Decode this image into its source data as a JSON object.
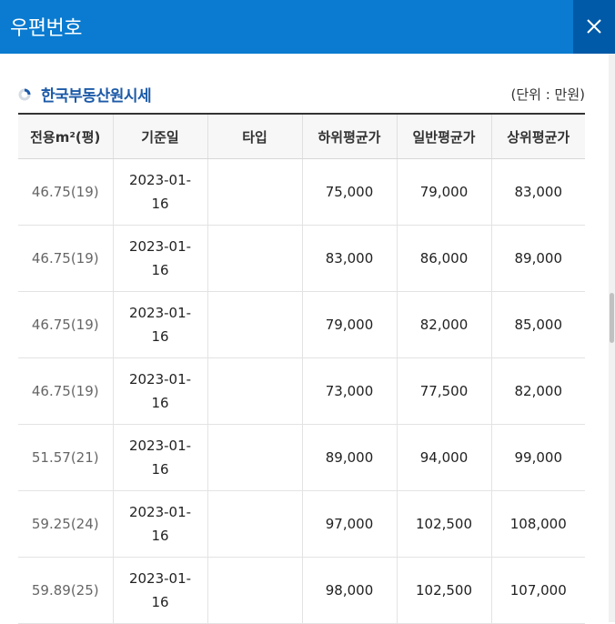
{
  "header": {
    "title": "우편번호"
  },
  "section": {
    "title": "한국부동산원시세",
    "unit_note": "(단위 : 만원)"
  },
  "table": {
    "columns": [
      "전용m²(평)",
      "기준일",
      "타입",
      "하위평균가",
      "일반평균가",
      "상위평균가"
    ],
    "rows": [
      {
        "area": "46.75(19)",
        "date_line1": "2023-01-",
        "date_line2": "16",
        "type": "",
        "low": "75,000",
        "mid": "79,000",
        "high": "83,000"
      },
      {
        "area": "46.75(19)",
        "date_line1": "2023-01-",
        "date_line2": "16",
        "type": "",
        "low": "83,000",
        "mid": "86,000",
        "high": "89,000"
      },
      {
        "area": "46.75(19)",
        "date_line1": "2023-01-",
        "date_line2": "16",
        "type": "",
        "low": "79,000",
        "mid": "82,000",
        "high": "85,000"
      },
      {
        "area": "46.75(19)",
        "date_line1": "2023-01-",
        "date_line2": "16",
        "type": "",
        "low": "73,000",
        "mid": "77,500",
        "high": "82,000"
      },
      {
        "area": "51.57(21)",
        "date_line1": "2023-01-",
        "date_line2": "16",
        "type": "",
        "low": "89,000",
        "mid": "94,000",
        "high": "99,000"
      },
      {
        "area": "59.25(24)",
        "date_line1": "2023-01-",
        "date_line2": "16",
        "type": "",
        "low": "97,000",
        "mid": "102,500",
        "high": "108,000"
      },
      {
        "area": "59.89(25)",
        "date_line1": "2023-01-",
        "date_line2": "16",
        "type": "",
        "low": "98,000",
        "mid": "102,500",
        "high": "107,000"
      }
    ]
  },
  "colors": {
    "header_bg": "#0a7bd0",
    "close_bg": "#005aa8",
    "section_title": "#1c5aa8"
  },
  "icons": {
    "close": "close-icon",
    "section": "loading-ring-icon"
  }
}
